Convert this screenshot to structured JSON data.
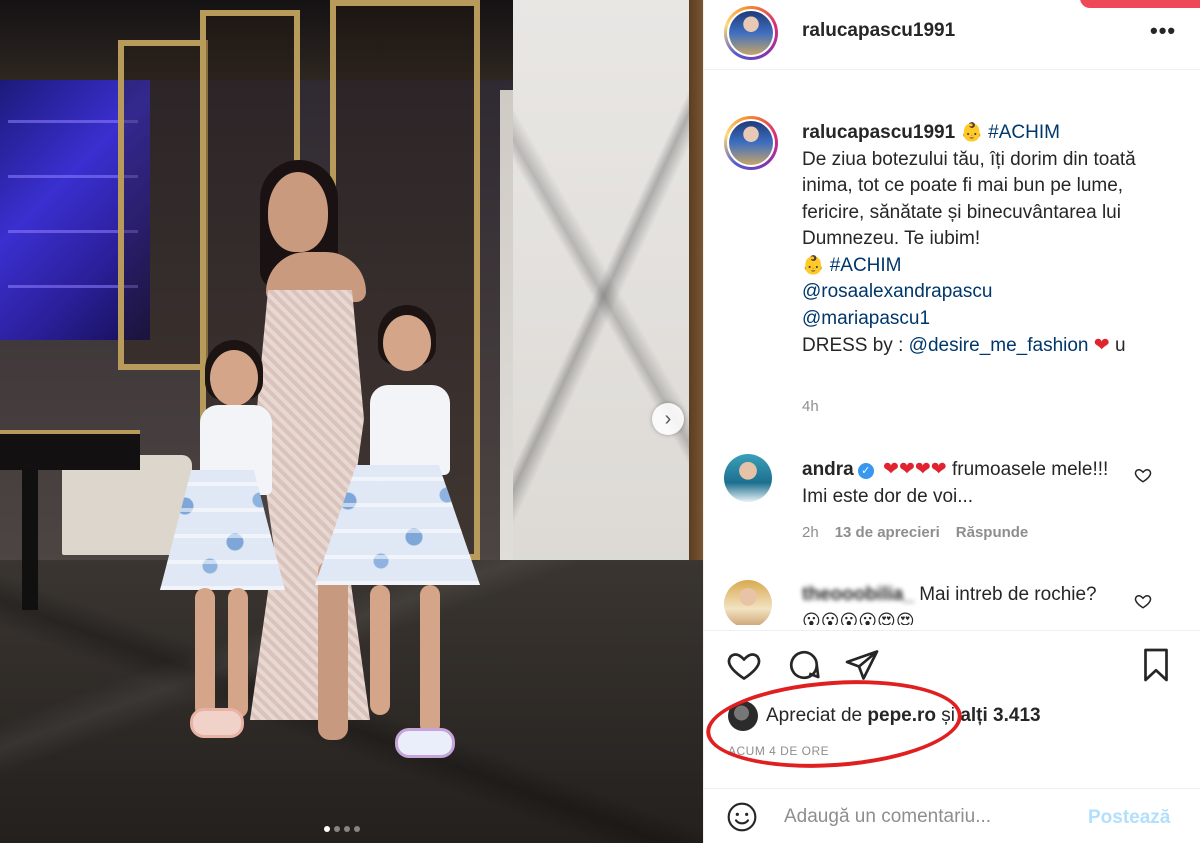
{
  "post": {
    "username": "ralucapascu1991",
    "more_label": "•••",
    "carousel_next": "›"
  },
  "caption": {
    "username": "ralucapascu1991",
    "hashtag_top": "#ACHIM",
    "text": "De ziua botezului tău, îți dorim din toată inima, tot ce poate fi mai bun pe lume, fericire, sănătate și binecuvântarea lui Dumnezeu. Te iubim!",
    "hashtag_line": "#ACHIM",
    "mention1": "@rosaalexandrapascu",
    "mention2": "@mariapascu1",
    "dress_prefix": "DRESS by : ",
    "dress_mention": "@desire_me_fashion",
    "dress_suffix": "u",
    "emoji": "👶",
    "heart": "❤",
    "time": "4h"
  },
  "comments": [
    {
      "username": "andra",
      "hearts": "❤❤❤❤",
      "text": "frumoasele mele!!! Imi este dor de voi...",
      "time": "2h",
      "likes": "13 de aprecieri",
      "reply": "Răspunde"
    },
    {
      "username": "theooobilia_",
      "text": "Mai intreb de rochie?",
      "emojis": "😮😮😮😮😍😍"
    }
  ],
  "likes": {
    "prefix": "Apreciat de ",
    "user": "pepe.ro",
    "middle": " și ",
    "others": "alți 3.413"
  },
  "time_ago": "ACUM 4 DE ORE",
  "comment_box": {
    "placeholder": "Adaugă un comentariu...",
    "post_label": "Postează"
  },
  "colors": {
    "link": "#00376b",
    "secondary_text": "#8e8e8e",
    "post_button": "#b2dffc",
    "annotation_ellipse": "#e02020",
    "verified": "#3897f0"
  },
  "icons": [
    "like-icon",
    "comment-icon",
    "share-icon",
    "save-icon",
    "smile-icon",
    "more-icon",
    "like-small-icon",
    "verified-icon"
  ]
}
